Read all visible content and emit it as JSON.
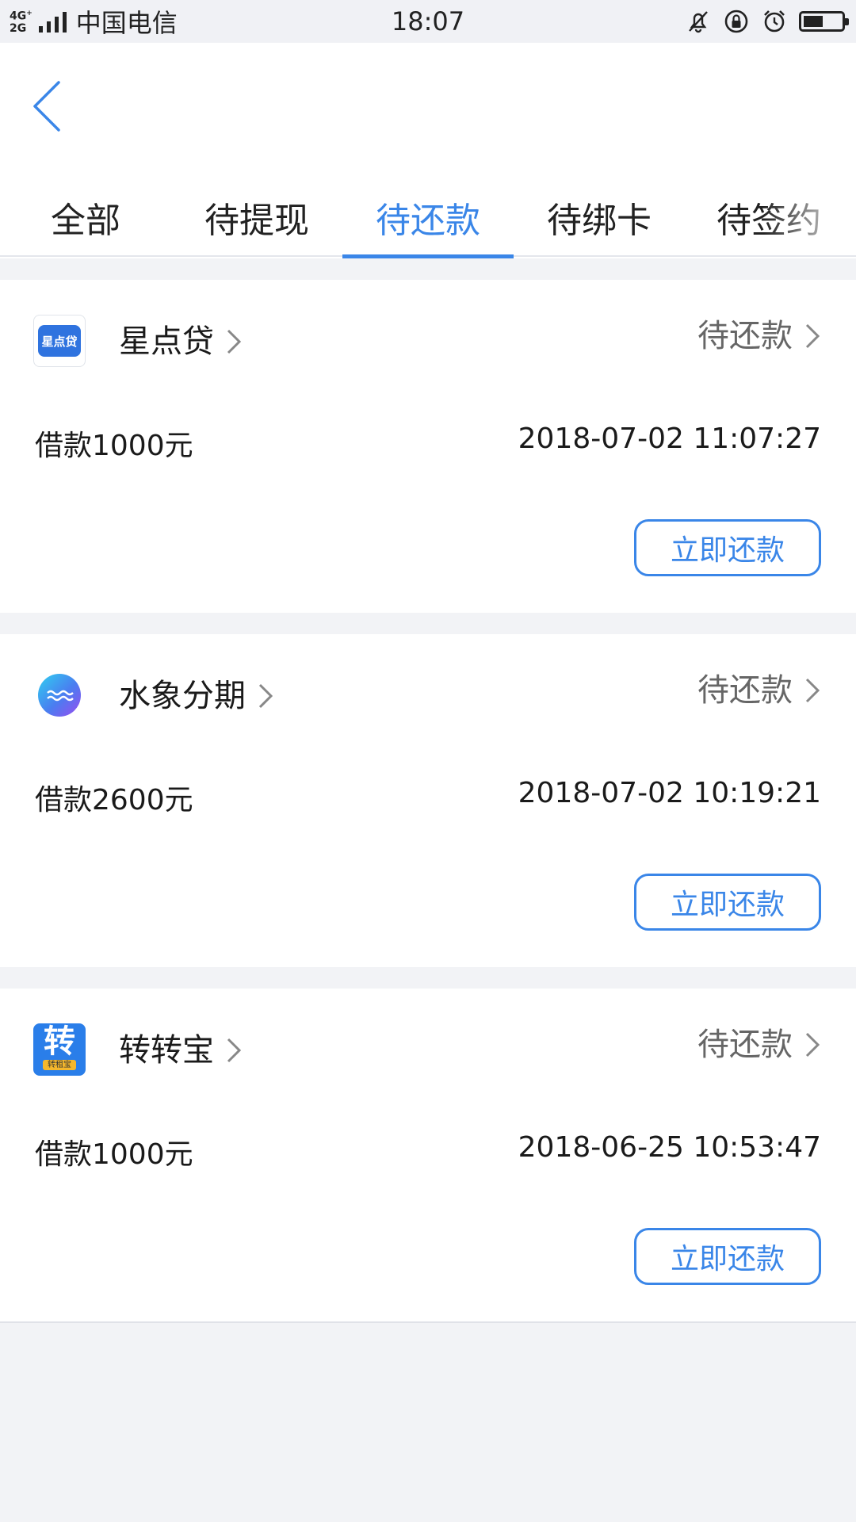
{
  "status_bar": {
    "network": "4G+ 2G",
    "carrier": "中国电信",
    "time": "18:07",
    "battery_level": 0.5
  },
  "header": {
    "tabs": [
      {
        "label": "全部",
        "active": false
      },
      {
        "label": "待提现",
        "active": false
      },
      {
        "label": "待还款",
        "active": true
      },
      {
        "label": "待绑卡",
        "active": false
      },
      {
        "label": "待签约",
        "active": false
      }
    ]
  },
  "loans": [
    {
      "app_name": "星点贷",
      "logo_text": "星点贷",
      "status": "待还款",
      "amount": "借款1000元",
      "datetime": "2018-07-02 11:07:27",
      "action": "立即还款"
    },
    {
      "app_name": "水象分期",
      "status": "待还款",
      "amount": "借款2600元",
      "datetime": "2018-07-02 10:19:21",
      "action": "立即还款"
    },
    {
      "app_name": "转转宝",
      "logo_text": "转",
      "logo_tag": "转租宝",
      "status": "待还款",
      "amount": "借款1000元",
      "datetime": "2018-06-25 10:53:47",
      "action": "立即还款"
    }
  ],
  "colors": {
    "accent": "#3a86e8",
    "background": "#f2f3f6",
    "card": "#ffffff",
    "secondary_text": "#666666"
  }
}
